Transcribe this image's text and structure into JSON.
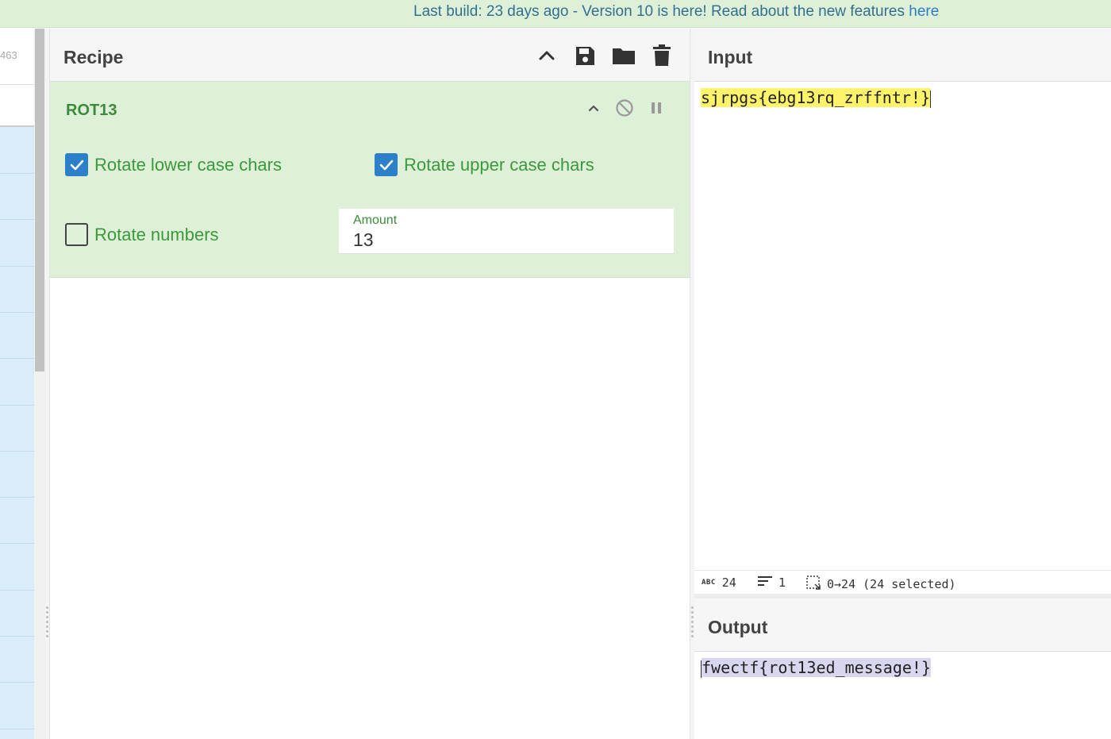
{
  "banner": {
    "text": "Last build: 23 days ago - Version 10 is here! Read about the new features ",
    "link": "here"
  },
  "operations": {
    "count": "463"
  },
  "recipe": {
    "title": "Recipe",
    "icons": [
      "chevron-up-icon",
      "save-icon",
      "folder-icon",
      "trash-icon"
    ],
    "operation": {
      "name": "ROT13",
      "rotate_lower": {
        "label": "Rotate lower case chars",
        "checked": true
      },
      "rotate_upper": {
        "label": "Rotate upper case chars",
        "checked": true
      },
      "rotate_numbers": {
        "label": "Rotate numbers",
        "checked": false
      },
      "amount": {
        "label": "Amount",
        "value": "13"
      }
    }
  },
  "input": {
    "title": "Input",
    "text": "sjrpgs{ebg13rq_zrffntr!}"
  },
  "status": {
    "length": "24",
    "lines": "1",
    "selection": "0→24 (24 selected)"
  },
  "output": {
    "title": "Output",
    "text": "fwectf{rot13ed_message!}"
  },
  "colors": {
    "banner_bg": "#dff0d8",
    "op_card_bg": "#dff0d8",
    "checkbox_on": "#2c7fc9",
    "label_green": "#3a9a3a",
    "input_highlight": "#fff469",
    "output_highlight": "#d9d6f0",
    "ops_list_bg": "#d9ecf7"
  }
}
